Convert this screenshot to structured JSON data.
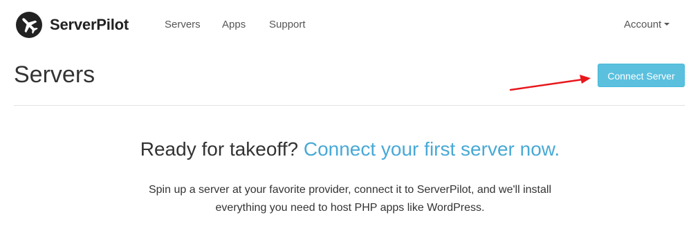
{
  "brand": {
    "name": "ServerPilot",
    "logo_icon": "airplane-icon",
    "logo_color": "#222222"
  },
  "nav": {
    "items": [
      {
        "label": "Servers"
      },
      {
        "label": "Apps"
      },
      {
        "label": "Support"
      }
    ],
    "account_label": "Account",
    "account_icon": "caret-down-icon"
  },
  "header": {
    "title": "Servers",
    "connect_button_label": "Connect Server",
    "connect_button_color": "#5bc0de"
  },
  "empty_state": {
    "headline_prefix": "Ready for takeoff?",
    "headline_link": "Connect your first server now.",
    "link_color": "#48a9d6",
    "description_line1": "Spin up a server at your favorite provider, connect it to ServerPilot, and we'll install",
    "description_line2": "everything you need to host PHP apps like WordPress."
  },
  "annotation": {
    "arrow_color": "#e8171c",
    "arrow_icon": "red-arrow-icon"
  }
}
